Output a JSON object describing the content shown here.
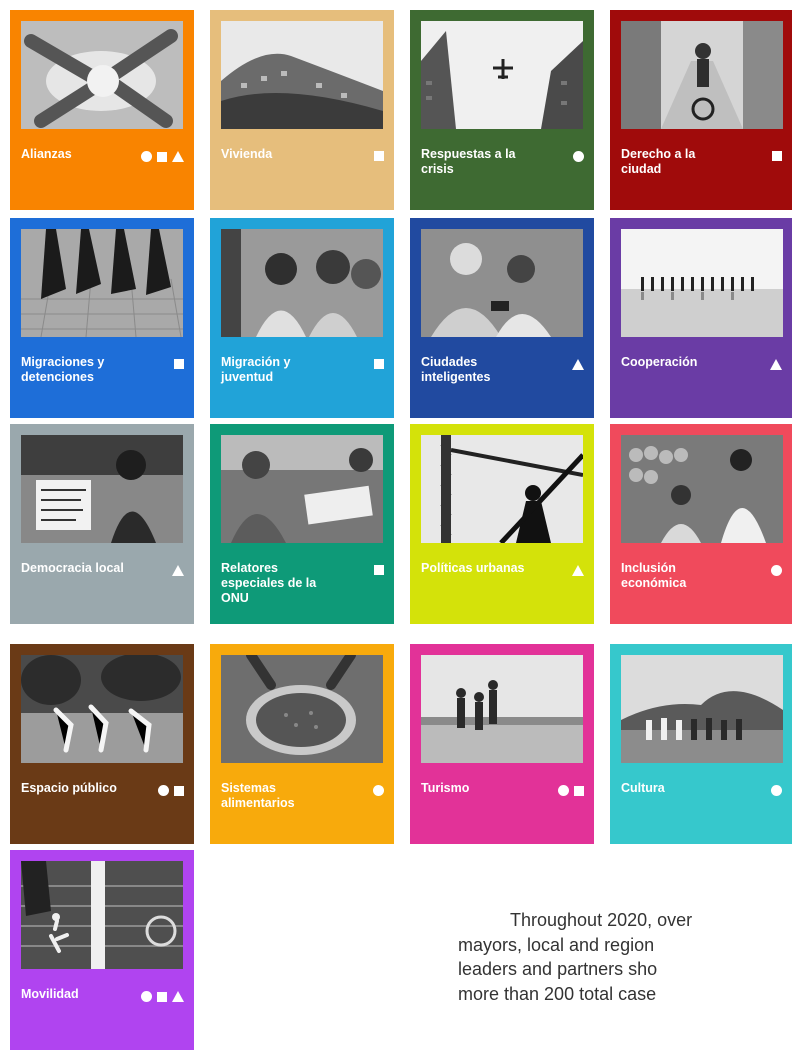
{
  "tiles": [
    {
      "label": "Alianzas",
      "color": "#f98400",
      "shapes": [
        "circle",
        "square",
        "triangle"
      ],
      "photo": "hands-together-photo"
    },
    {
      "label": "Vivienda",
      "color": "#e6be7c",
      "shapes": [
        "square"
      ],
      "photo": "hillside-housing-photo"
    },
    {
      "label": "Respuestas a la crisis",
      "color": "#3e6a32",
      "shapes": [
        "circle"
      ],
      "photo": "airplane-skyscrapers-photo"
    },
    {
      "label": "Derecho a la ciudad",
      "color": "#a00b0b",
      "shapes": [
        "square"
      ],
      "photo": "street-cyclist-photo"
    },
    {
      "label": "Migraciones y detenciones",
      "color": "#1e6ed8",
      "shapes": [
        "square"
      ],
      "photo": "shadows-on-pavement-photo"
    },
    {
      "label": "Migración y juventud",
      "color": "#21a3d8",
      "shapes": [
        "square"
      ],
      "photo": "young-people-photo"
    },
    {
      "label": "Ciudades inteligentes",
      "color": "#214aa0",
      "shapes": [
        "triangle"
      ],
      "photo": "people-with-phones-photo"
    },
    {
      "label": "Cooperación",
      "color": "#6a3ca5",
      "shapes": [
        "triangle"
      ],
      "photo": "people-on-beach-photo"
    },
    {
      "label": "Democracia local",
      "color": "#9aa8ad",
      "shapes": [
        "triangle"
      ],
      "photo": "woman-with-protest-sign-photo"
    },
    {
      "label": "Relatores especiales de la ONU",
      "color": "#0e9a78",
      "shapes": [
        "square"
      ],
      "photo": "meeting-notebooks-photo"
    },
    {
      "label": "Políticas urbanas",
      "color": "#d4e20a",
      "shapes": [
        "triangle"
      ],
      "photo": "construction-crane-photo"
    },
    {
      "label": "Inclusión económica",
      "color": "#f04a5c",
      "shapes": [
        "circle"
      ],
      "photo": "market-stall-photo"
    },
    {
      "label": "Espacio público",
      "color": "#6a3a16",
      "shapes": [
        "circle",
        "square"
      ],
      "photo": "park-exercise-photo"
    },
    {
      "label": "Sistemas alimentarios",
      "color": "#f8aa0c",
      "shapes": [
        "circle"
      ],
      "photo": "grain-basket-photo"
    },
    {
      "label": "Turismo",
      "color": "#e23298",
      "shapes": [
        "circle",
        "square"
      ],
      "photo": "tourists-waterfront-photo"
    },
    {
      "label": "Cultura",
      "color": "#36c8cc",
      "shapes": [
        "circle"
      ],
      "photo": "group-landscape-photo"
    },
    {
      "label": "Movilidad",
      "color": "#b044f0",
      "shapes": [
        "circle",
        "square",
        "triangle"
      ],
      "photo": "crosswalk-pedestrians-photo"
    }
  ],
  "body_text": {
    "line1": "Throughout 2020, over",
    "line2": "mayors, local and region",
    "line3": "leaders and partners sho",
    "line4": "more than 200 total case"
  }
}
